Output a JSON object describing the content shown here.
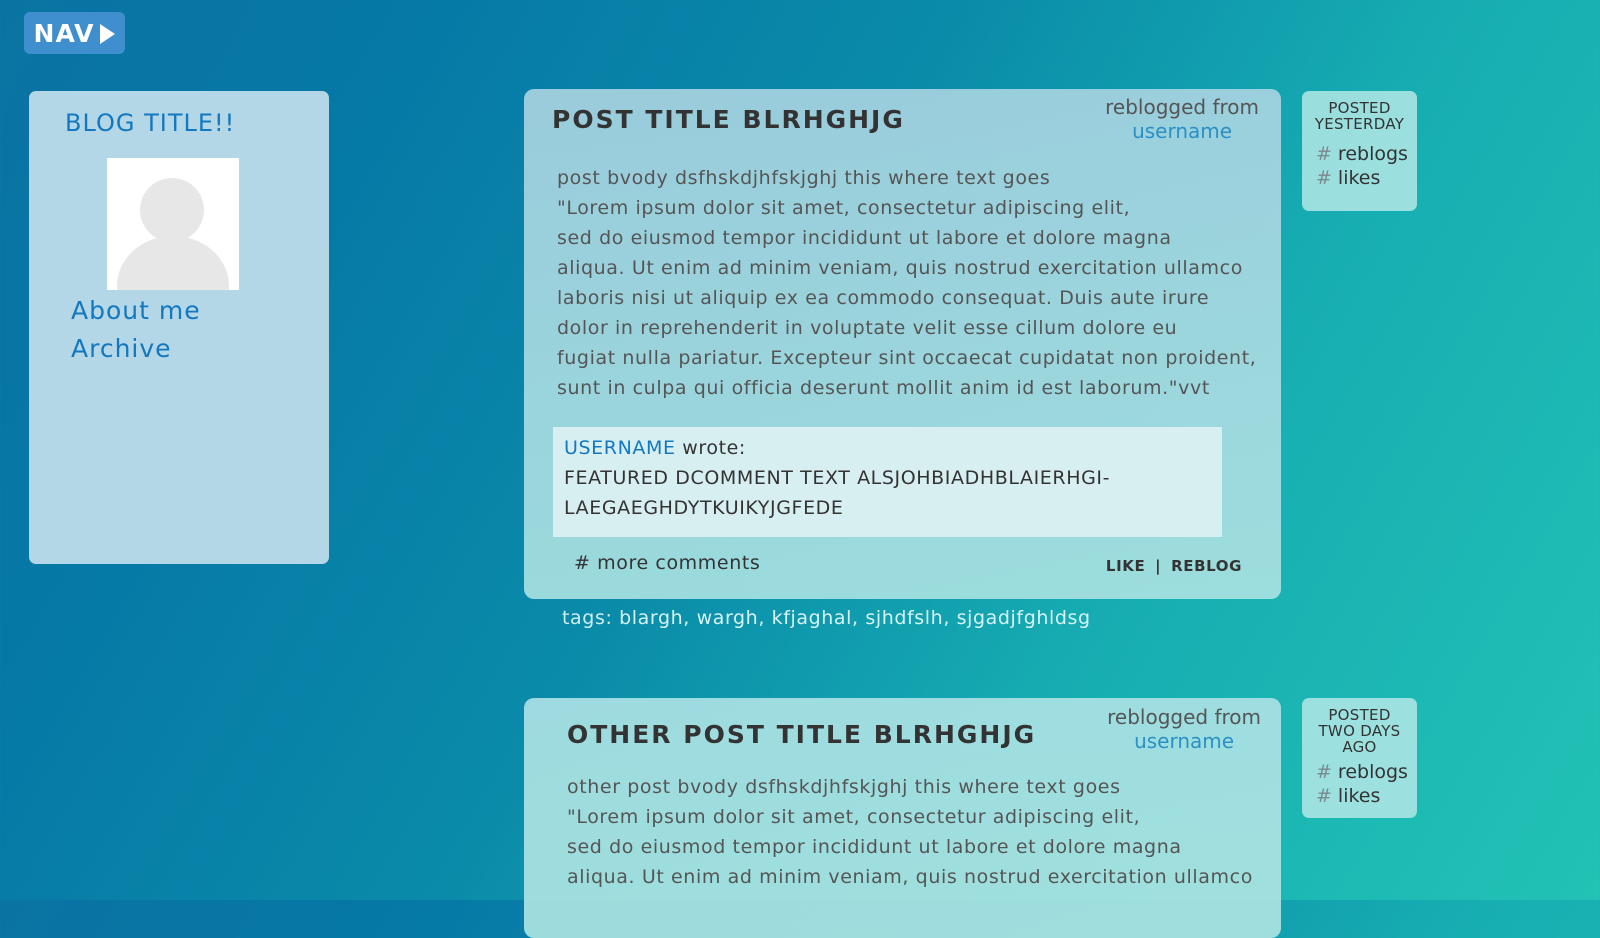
{
  "nav": {
    "label": "NAV"
  },
  "sidebar": {
    "title": "BLOG TITLE!!",
    "links": [
      {
        "label": "About me"
      },
      {
        "label": "Archive"
      }
    ]
  },
  "posts": [
    {
      "title": "POST TITLE BLRHGHJG",
      "reblogged_label": "reblogged from",
      "reblogged_user": "username",
      "body": "post bvody dsfhskdjhfskjghj this where text goes\n\"Lorem ipsum dolor sit amet, consectetur adipiscing elit,\nsed do eiusmod tempor incididunt ut labore et dolore magna\naliqua. Ut enim ad minim veniam, quis nostrud exercitation ullamco\nlaboris nisi ut aliquip ex ea commodo consequat. Duis aute irure\ndolor in reprehenderit in voluptate velit esse cillum dolore eu\nfugiat nulla pariatur. Excepteur sint occaecat cupidatat non proident,\nsunt in culpa qui officia deserunt mollit anim id est laborum.\"vvt",
      "featured_user": "USERNAME",
      "featured_wrote": "wrote:",
      "featured_text": "FEATURED DCOMMENT TEXT ALSJOHBIADHBLAIERHGI-\nLAEGAEGHDYTKUIKYJGFEDE",
      "more_comments": "# more comments",
      "like": "LIKE",
      "separator": "|",
      "reblog": "REBLOG",
      "tags_label": "tags:",
      "tags": [
        "blargh,",
        "wargh,",
        "kfjaghal,",
        "sjhdfslh,",
        "sjgadjfghldsg"
      ],
      "meta": {
        "when_1": "POSTED",
        "when_2": "YESTERDAY",
        "reblogs": "reblogs",
        "likes": "likes",
        "hash": "#"
      }
    },
    {
      "title": "OTHER POST TITLE BLRHGHJG",
      "reblogged_label": "reblogged from",
      "reblogged_user": "username",
      "body": "other post bvody dsfhskdjhfskjghj this where text goes\n\"Lorem ipsum dolor sit amet, consectetur adipiscing elit,\nsed do eiusmod tempor incididunt ut labore et dolore magna\naliqua. Ut enim ad minim veniam, quis nostrud exercitation ullamco",
      "meta": {
        "when_1": "POSTED",
        "when_2": "TWO DAYS",
        "when_3": "AGO",
        "reblogs": "reblogs",
        "likes": "likes",
        "hash": "#"
      }
    }
  ]
}
